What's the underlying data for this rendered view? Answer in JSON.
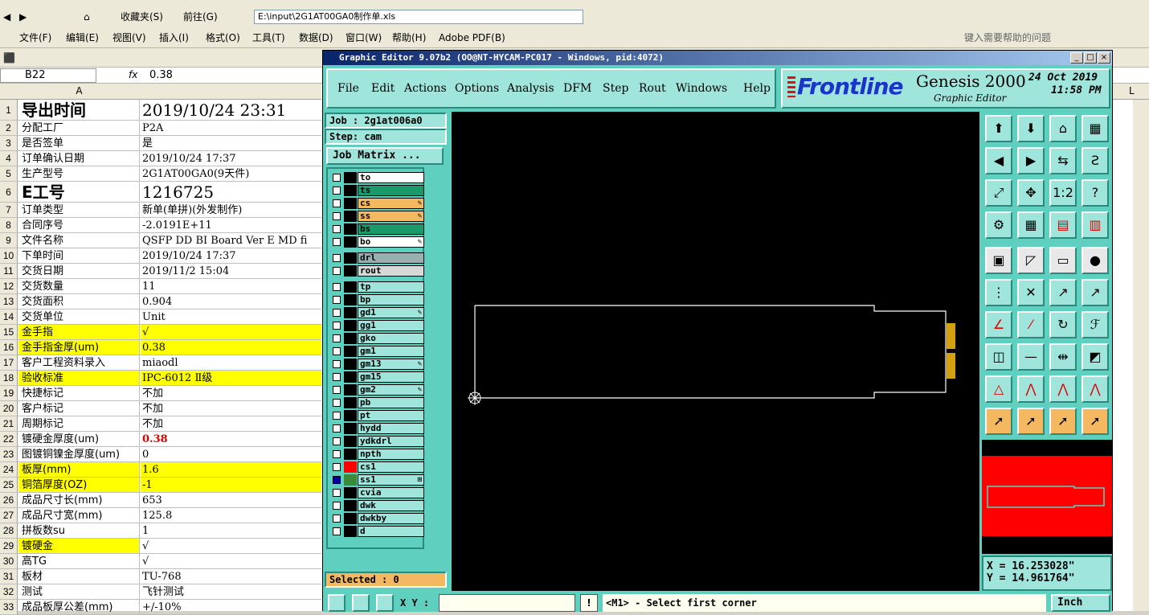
{
  "excel": {
    "address": "E:\\input\\2G1AT00GA0制作单.xls",
    "nav": {
      "favorites": "收藏夹(S)",
      "go": "前往(G)"
    },
    "menu": [
      "文件(F)",
      "编辑(E)",
      "视图(V)",
      "插入(I)",
      "格式(O)",
      "工具(T)",
      "数据(D)",
      "窗口(W)",
      "帮助(H)",
      "Adobe PDF(B)"
    ],
    "help_placeholder": "键入需要帮助的问题",
    "namebox": "B22",
    "fx": "fx",
    "formula": "0.38",
    "col_a": "A",
    "col_l": "L",
    "rows": [
      {
        "n": "1",
        "a": "导出时间",
        "b": "2019/10/24 23:31"
      },
      {
        "n": "2",
        "a": "分配工厂",
        "b": "P2A"
      },
      {
        "n": "3",
        "a": "是否签单",
        "b": "是"
      },
      {
        "n": "4",
        "a": "订单确认日期",
        "b": "2019/10/24 17:37"
      },
      {
        "n": "5",
        "a": "生产型号",
        "b": "2G1AT00GA0(9天件)"
      },
      {
        "n": "6",
        "a": "E工号",
        "b": "1216725"
      },
      {
        "n": "7",
        "a": "订单类型",
        "b": "新单(单拼)(外发制作)"
      },
      {
        "n": "8",
        "a": "合同序号",
        "b": "-2.0191E+11"
      },
      {
        "n": "9",
        "a": "文件名称",
        "b": "QSFP DD BI Board Ver E MD fi"
      },
      {
        "n": "10",
        "a": "下单时间",
        "b": "2019/10/24 17:37"
      },
      {
        "n": "11",
        "a": "交货日期",
        "b": "2019/11/2 15:04"
      },
      {
        "n": "12",
        "a": "交货数量",
        "b": "11"
      },
      {
        "n": "13",
        "a": "交货面积",
        "b": "0.904"
      },
      {
        "n": "14",
        "a": "交货单位",
        "b": "Unit"
      },
      {
        "n": "15",
        "a": "金手指",
        "b": "√"
      },
      {
        "n": "16",
        "a": "金手指金厚(um)",
        "b": "0.38"
      },
      {
        "n": "17",
        "a": "客户工程资料录入",
        "b": "miaodl"
      },
      {
        "n": "18",
        "a": "验收标准",
        "b": "IPC-6012 Ⅱ级"
      },
      {
        "n": "19",
        "a": "快捷标记",
        "b": "不加"
      },
      {
        "n": "20",
        "a": "客户标记",
        "b": "不加"
      },
      {
        "n": "21",
        "a": "周期标记",
        "b": "不加"
      },
      {
        "n": "22",
        "a": "镀硬金厚度(um)",
        "b": "0.38"
      },
      {
        "n": "23",
        "a": "图镀铜镍金厚度(um)",
        "b": "0"
      },
      {
        "n": "24",
        "a": "板厚(mm)",
        "b": "1.6"
      },
      {
        "n": "25",
        "a": "铜箔厚度(OZ)",
        "b": "-1"
      },
      {
        "n": "26",
        "a": "成品尺寸长(mm)",
        "b": "653"
      },
      {
        "n": "27",
        "a": "成品尺寸宽(mm)",
        "b": "125.8"
      },
      {
        "n": "28",
        "a": "拼板数su",
        "b": "1"
      },
      {
        "n": "29",
        "a": "镀硬金",
        "b": "√"
      },
      {
        "n": "30",
        "a": "高TG",
        "b": "√"
      },
      {
        "n": "31",
        "a": "板材",
        "b": "TU-768"
      },
      {
        "n": "32",
        "a": "测试",
        "b": "飞针测试"
      },
      {
        "n": "33",
        "a": "成品板厚公差(mm)",
        "b": "+/-10%"
      }
    ]
  },
  "genesis": {
    "title": "Graphic Editor 9.07b2 (OO@NT-HYCAM-PC017 - Windows, pid:4072)",
    "menu": [
      "File",
      "Edit",
      "Actions",
      "Options",
      "Analysis",
      "DFM",
      "Step",
      "Rout",
      "Windows",
      "Help"
    ],
    "brand": "Frontline",
    "product": "Genesis 2000",
    "subtitle": "Graphic Editor",
    "date": "24 Oct 2019",
    "time": "11:58 PM",
    "job": "Job : 2g1at006a0",
    "step": "Step: cam",
    "job_matrix": "Job Matrix ...",
    "layers": [
      {
        "name": "to",
        "color": "#ffffff"
      },
      {
        "name": "ts",
        "color": "#1a9a6a"
      },
      {
        "name": "cs",
        "color": "#f4b860",
        "mark": "✎"
      },
      {
        "name": "ss",
        "color": "#f4b860",
        "mark": "✎"
      },
      {
        "name": "bs",
        "color": "#1a9a6a"
      },
      {
        "name": "bo",
        "color": "#ffffff",
        "mark": "✎"
      },
      {
        "name": "drl",
        "color": "#9ab0b0"
      },
      {
        "name": "rout",
        "color": "#d8d8d8"
      },
      {
        "name": "tp",
        "color": "#9fe5dc"
      },
      {
        "name": "bp",
        "color": "#9fe5dc"
      },
      {
        "name": "gd1",
        "color": "#9fe5dc",
        "mark": "✎"
      },
      {
        "name": "gg1",
        "color": "#9fe5dc"
      },
      {
        "name": "gko",
        "color": "#9fe5dc"
      },
      {
        "name": "gm1",
        "color": "#9fe5dc"
      },
      {
        "name": "gm13",
        "color": "#9fe5dc",
        "mark": "✎"
      },
      {
        "name": "gm15",
        "color": "#9fe5dc"
      },
      {
        "name": "gm2",
        "color": "#9fe5dc",
        "mark": "✎"
      },
      {
        "name": "pb",
        "color": "#9fe5dc"
      },
      {
        "name": "pt",
        "color": "#9fe5dc"
      },
      {
        "name": "hydd",
        "color": "#9fe5dc"
      },
      {
        "name": "ydkdrl",
        "color": "#9fe5dc"
      },
      {
        "name": "npth",
        "color": "#9fe5dc"
      },
      {
        "name": "cs1",
        "color": "#9fe5dc",
        "swatch": "#ff0000"
      },
      {
        "name": "ss1",
        "color": "#9fe5dc",
        "swatch": "#3a8a3a",
        "mark": "⊞",
        "checked": true
      },
      {
        "name": "cvia",
        "color": "#9fe5dc"
      },
      {
        "name": "dwk",
        "color": "#9fe5dc"
      },
      {
        "name": "dwkby",
        "color": "#9fe5dc"
      },
      {
        "name": "d",
        "color": "#9fe5dc"
      }
    ],
    "selected": "Selected : 0",
    "x": "X  =  16.253028\"",
    "y": "Y  =  14.961764\"",
    "xy_label": "X Y :",
    "prompt": "<M1> - Select first corner",
    "units": "Inch",
    "tool_icons": [
      "send-up",
      "send-down",
      "home-view",
      "grid-view",
      "move-left",
      "move-right",
      "mirror",
      "s-curve",
      "zoom-fit",
      "zoom-center",
      "one-to-two",
      "help",
      "tools",
      "grid",
      "layer-red",
      "layer-red2",
      "square-frame",
      "pencil-shape",
      "ruler",
      "dot",
      "nodes",
      "cross",
      "line-node",
      "line-node2",
      "angle-red",
      "line-red",
      "rotate",
      "ff",
      "box-dot",
      "minus",
      "measure",
      "squares",
      "triangle",
      "triangle2",
      "triangle3",
      "triangle4",
      "arrow",
      "arrow2",
      "arrow3",
      "arrow4"
    ]
  }
}
